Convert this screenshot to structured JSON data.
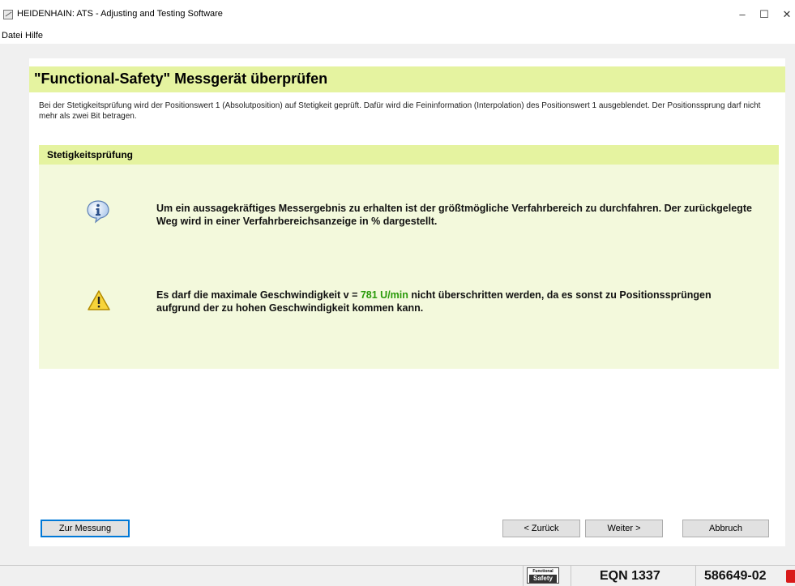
{
  "window": {
    "title": "HEIDENHAIN: ATS - Adjusting and Testing Software",
    "minimize": "–",
    "maximize": "☐",
    "close": "✕"
  },
  "menu": {
    "items": [
      "Datei",
      "Hilfe"
    ]
  },
  "page": {
    "title": "\"Functional-Safety\" Messgerät überprüfen",
    "description": "Bei der Stetigkeitsprüfung wird der Positionswert 1 (Absolutposition) auf Stetigkeit geprüft. Dafür wird die Feininformation (Interpolation) des Positionswert 1 ausgeblendet. Der Positionssprung darf nicht mehr als zwei Bit betragen."
  },
  "section": {
    "title": "Stetigkeitsprüfung",
    "info_message": "Um ein aussagekräftiges Messergebnis zu erhalten ist der größtmögliche Verfahrbereich zu durchfahren. Der zurückgelegte Weg wird in einer Verfahrbereichsanzeige in % dargestellt.",
    "warning_prefix": "Es darf die maximale Geschwindigkeit v = ",
    "warning_speed": "781 U/min",
    "warning_suffix": " nicht überschritten werden, da es sonst zu Positionssprüngen aufgrund der zu hohen Geschwindigkeit kommen kann.",
    "speed_color": "#2a9a0a"
  },
  "buttons": {
    "measure": "Zur Messung",
    "back": "< Zurück",
    "next": "Weiter >",
    "cancel": "Abbruch"
  },
  "status": {
    "logo_top": "Functional",
    "logo_bottom": "Safety",
    "device": "EQN 1337",
    "id": "586649-02"
  },
  "colors": {
    "header_bg": "#e5f3a0",
    "body_bg": "#f3f9dc"
  },
  "icons": [
    "info-icon",
    "warning-icon",
    "functional-safety-logo",
    "status-icon"
  ]
}
